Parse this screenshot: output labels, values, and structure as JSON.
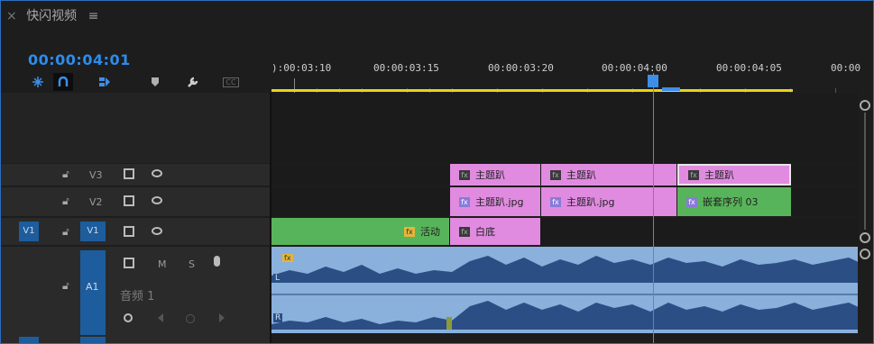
{
  "panel": {
    "close": "×",
    "title": "快闪视频",
    "menu": "≡"
  },
  "timecode": "00:00:04:01",
  "ruler": {
    "labels": [
      "):00:03:10",
      "00:00:03:15",
      "00:00:03:20",
      "00:00:04:00",
      "00:00:04:05",
      "00:00"
    ]
  },
  "tools": [
    "snap-icon",
    "magnet-icon",
    "linked-selection-icon",
    "marker-icon",
    "wrench-icon",
    "captions-icon"
  ],
  "tool_captions": "CC",
  "tracks": {
    "v3": {
      "name": "V3"
    },
    "v2": {
      "name": "V2"
    },
    "v1": {
      "source": "V1",
      "name": "V1"
    },
    "a1": {
      "name": "A1",
      "label": "音频 1",
      "m": "M",
      "s": "S"
    }
  },
  "clips": {
    "v3_1": "主题趴",
    "v3_2": "主题趴",
    "v3_3": "主题趴",
    "v2_1": "主题趴.jpg",
    "v2_2": "主题趴.jpg",
    "v2_3": "嵌套序列 03",
    "v1_1": "活动",
    "v1_2": "白底"
  },
  "audio_channels": {
    "left": "L",
    "right": "R"
  },
  "fx_label": "fx",
  "colors": {
    "accent": "#2d8ceb",
    "clip_pink": "#e08be0",
    "clip_green": "#58b45a",
    "audio": "#8ab0dc"
  }
}
